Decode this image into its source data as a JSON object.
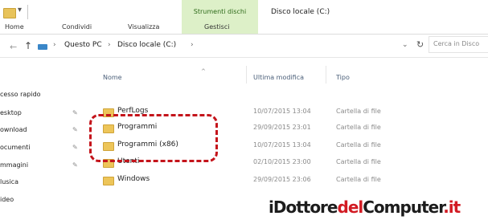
{
  "ribbon": {
    "tabs": [
      "Home",
      "Condividi",
      "Visualizza",
      "Gestisci"
    ],
    "context_tab": "Strumenti dischi",
    "window_title": "Disco locale (C:)"
  },
  "address": {
    "breadcrumbs": [
      "Questo PC",
      "Disco locale (C:)"
    ],
    "search_placeholder": "Cerca in Disco"
  },
  "columns": [
    "Nome",
    "Ultima modifica",
    "Tipo"
  ],
  "nav_pane": [
    "cesso rapido",
    "esktop",
    "ownload",
    "ocumenti",
    "mmagini",
    "lusica",
    "ideo"
  ],
  "files": [
    {
      "name": "PerfLogs",
      "date": "10/07/2015 13:04",
      "type": "Cartella di file"
    },
    {
      "name": "Programmi",
      "date": "29/09/2015 23:01",
      "type": "Cartella di file"
    },
    {
      "name": "Programmi (x86)",
      "date": "10/07/2015 13:04",
      "type": "Cartella di file"
    },
    {
      "name": "Utenti",
      "date": "02/10/2015 23:00",
      "type": "Cartella di file"
    },
    {
      "name": "Windows",
      "date": "29/09/2015 23:06",
      "type": "Cartella di file"
    }
  ],
  "watermark": {
    "p1": "iDottore",
    "p2": "del",
    "p3": "Computer",
    "p4": ".it"
  },
  "colors": {
    "highlight": "#c4141b",
    "context_tab_bg": "#ddf0c8",
    "folder": "#edc559"
  }
}
